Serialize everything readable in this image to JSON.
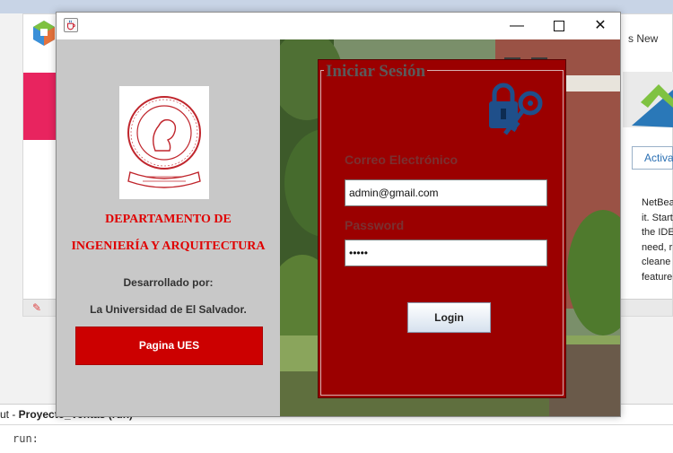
{
  "background_ide": {
    "whats_new": "s New",
    "activate_button": "Activa",
    "netbeans_text": [
      "NetBea",
      "it. Start",
      "the IDE",
      "need, r",
      "cleane",
      "feature"
    ],
    "output_tab_prefix": "ut - ",
    "output_tab_name": "Proyecto_Ventas (run)",
    "output_tab_close": "×",
    "output_line": "run:"
  },
  "window": {
    "icon": "java-cup-icon",
    "minimize": "—",
    "close": "✕"
  },
  "left_panel": {
    "seal_text_top": "UNIVERSIDAD DE EL SALVADOR",
    "seal_text_bottom": "CENTRO AMERICA",
    "department_line1": "DEPARTAMENTO DE",
    "department_line2": "INGENIERÍA Y ARQUITECTURA",
    "developed_by": "Desarrollado por:",
    "developer": "La Universidad de El Salvador.",
    "ues_button": "Pagina UES"
  },
  "login": {
    "title": "Iniciar Sesión",
    "email_label": "Correo Electrónico",
    "email_value": "admin@gmail.com",
    "password_label": "Password",
    "password_value": "•••••",
    "login_button": "Login",
    "icon": "lock-key-icon"
  },
  "colors": {
    "panel_red": "#9b0000",
    "button_red": "#cc0000",
    "heading_red": "#e00000",
    "left_gray": "#c8c8c8"
  }
}
